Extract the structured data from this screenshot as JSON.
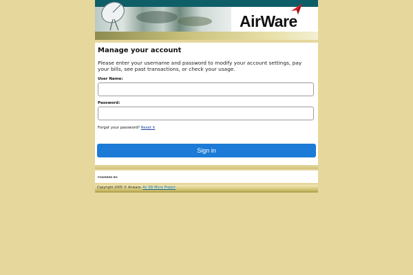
{
  "header": {
    "logo_text": "AirWare"
  },
  "login": {
    "title": "Manage your account",
    "intro": "Please enter your username and password to modify your account settings, pay your bills, see past transactions, or check your usage.",
    "username_label": "User Name:",
    "username_value": "",
    "password_label": "Password:",
    "password_value": "",
    "forgot_text": "Forgot your password?",
    "reset_link": "Reset it",
    "signin_label": "Sign in"
  },
  "powered": {
    "label": "POWERED BY:"
  },
  "footer": {
    "copyright": "Copyright 2005 © Airware.",
    "project_link": "An SSI Micro Project"
  },
  "colors": {
    "page_background": "#e6d79d",
    "header_strip": "#0e5e68",
    "signin_button": "#1b7bd6",
    "logo_arrow": "#d8242b"
  }
}
